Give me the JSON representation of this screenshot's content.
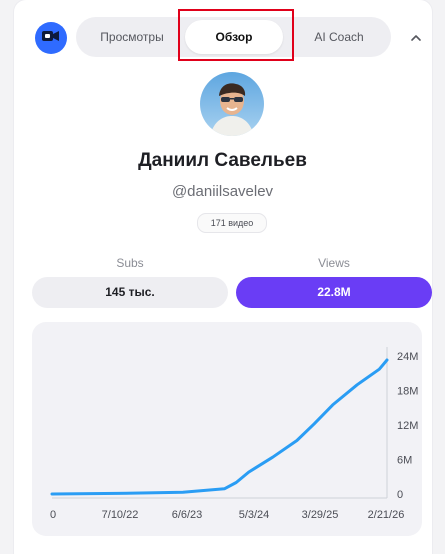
{
  "tabs": [
    {
      "label": "Просмотры",
      "active": false
    },
    {
      "label": "Обзор",
      "active": true
    },
    {
      "label": "AI Coach",
      "active": false
    }
  ],
  "icons": {
    "logo": "camera-logo-icon",
    "collapse": "chevron-up-icon"
  },
  "profile": {
    "name": "Даниил Савельев",
    "handle": "@daniilsavelev",
    "video_count": "171 видео"
  },
  "stats": {
    "subs_label": "Subs",
    "subs_value": "145 тыс.",
    "views_label": "Views",
    "views_value": "22.8M"
  },
  "colors": {
    "accent": "#6a3df5",
    "logo_blue": "#2f6bff",
    "line": "#2a9df4",
    "highlight": "#e0001a"
  },
  "chart_data": {
    "type": "line",
    "title": "",
    "xlabel": "",
    "ylabel": "",
    "x_tick_labels": [
      "0",
      "7/10/22",
      "6/6/23",
      "5/3/24",
      "3/29/25",
      "2/21/26"
    ],
    "y_tick_labels": [
      "0",
      "6M",
      "12M",
      "18M",
      "24M"
    ],
    "ylim": [
      0,
      24000000
    ],
    "grid": false,
    "series": [
      {
        "x": [
          "8/14/21",
          "7/10/22",
          "6/6/23",
          "1/1/24",
          "3/1/24",
          "5/3/24",
          "9/1/24",
          "1/1/25",
          "3/29/25",
          "7/1/25",
          "11/1/25",
          "2/21/26",
          "4/1/26"
        ],
        "values": [
          0,
          100000,
          300000,
          900000,
          2000000,
          3800000,
          6400000,
          9300000,
          12200000,
          15500000,
          19000000,
          21700000,
          23300000
        ]
      }
    ]
  }
}
